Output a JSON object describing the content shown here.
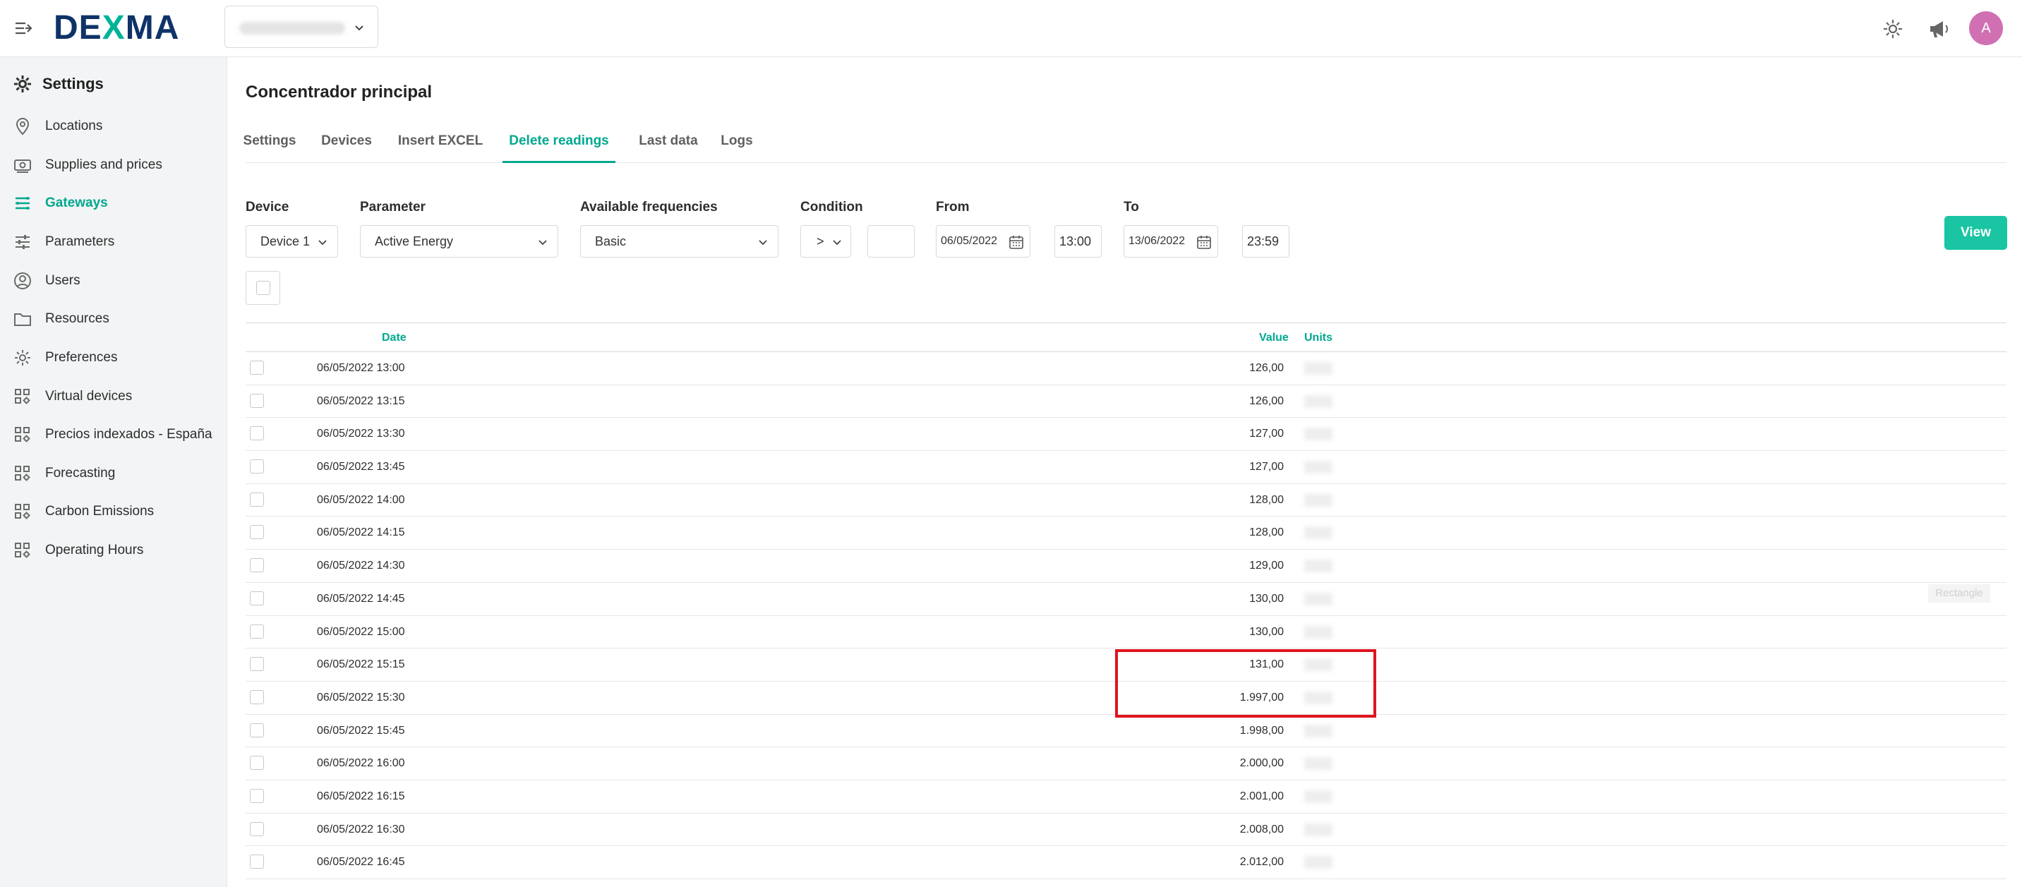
{
  "brand": {
    "logo_pre": "DE",
    "logo_x": "X",
    "logo_post": "MA"
  },
  "header": {
    "avatar_initial": "A"
  },
  "sidebar": {
    "title": "Settings",
    "items": [
      {
        "label": "Locations",
        "icon": "location-pin-icon"
      },
      {
        "label": "Supplies and prices",
        "icon": "money-icon"
      },
      {
        "label": "Gateways",
        "icon": "gateway-icon",
        "active": true
      },
      {
        "label": "Parameters",
        "icon": "sliders-icon"
      },
      {
        "label": "Users",
        "icon": "user-icon"
      },
      {
        "label": "Resources",
        "icon": "folder-icon"
      },
      {
        "label": "Preferences",
        "icon": "gear-icon"
      },
      {
        "label": "Virtual devices",
        "icon": "apps-gear-icon"
      },
      {
        "label": "Precios indexados - España",
        "icon": "apps-gear-icon"
      },
      {
        "label": "Forecasting",
        "icon": "apps-gear-icon"
      },
      {
        "label": "Carbon Emissions",
        "icon": "apps-gear-icon"
      },
      {
        "label": "Operating Hours",
        "icon": "apps-gear-icon"
      }
    ]
  },
  "main": {
    "title": "Concentrador principal",
    "tabs": [
      {
        "label": "Settings"
      },
      {
        "label": "Devices"
      },
      {
        "label": "Insert EXCEL"
      },
      {
        "label": "Delete readings",
        "active": true
      },
      {
        "label": "Last data"
      },
      {
        "label": "Logs"
      }
    ]
  },
  "filters": {
    "device_label": "Device",
    "device_value": "Device 1",
    "parameter_label": "Parameter",
    "parameter_value": "Active Energy",
    "frequency_label": "Available frequencies",
    "frequency_value": "Basic",
    "condition_label": "Condition",
    "condition_value": ">",
    "condition_input": "",
    "from_label": "From",
    "from_date": "06/05/2022",
    "from_time": "13:00",
    "to_label": "To",
    "to_date": "13/06/2022",
    "to_time": "23:59",
    "view_button": "View"
  },
  "table": {
    "columns": {
      "date": "Date",
      "value": "Value",
      "units": "Units"
    },
    "rows": [
      {
        "date": "06/05/2022 13:00",
        "value": "126,00"
      },
      {
        "date": "06/05/2022 13:15",
        "value": "126,00"
      },
      {
        "date": "06/05/2022 13:30",
        "value": "127,00"
      },
      {
        "date": "06/05/2022 13:45",
        "value": "127,00"
      },
      {
        "date": "06/05/2022 14:00",
        "value": "128,00"
      },
      {
        "date": "06/05/2022 14:15",
        "value": "128,00"
      },
      {
        "date": "06/05/2022 14:30",
        "value": "129,00"
      },
      {
        "date": "06/05/2022 14:45",
        "value": "130,00"
      },
      {
        "date": "06/05/2022 15:00",
        "value": "130,00"
      },
      {
        "date": "06/05/2022 15:15",
        "value": "131,00"
      },
      {
        "date": "06/05/2022 15:30",
        "value": "1.997,00"
      },
      {
        "date": "06/05/2022 15:45",
        "value": "1.998,00"
      },
      {
        "date": "06/05/2022 16:00",
        "value": "2.000,00"
      },
      {
        "date": "06/05/2022 16:15",
        "value": "2.001,00"
      },
      {
        "date": "06/05/2022 16:30",
        "value": "2.008,00"
      },
      {
        "date": "06/05/2022 16:45",
        "value": "2.012,00"
      }
    ]
  },
  "annotation": {
    "ghost_label": "Rectangle",
    "highlight_color": "#e0141e"
  },
  "colors": {
    "accent": "#00a88f",
    "brand_navy": "#0f3368",
    "view_button": "#19c5a3",
    "avatar": "#d070b3"
  }
}
